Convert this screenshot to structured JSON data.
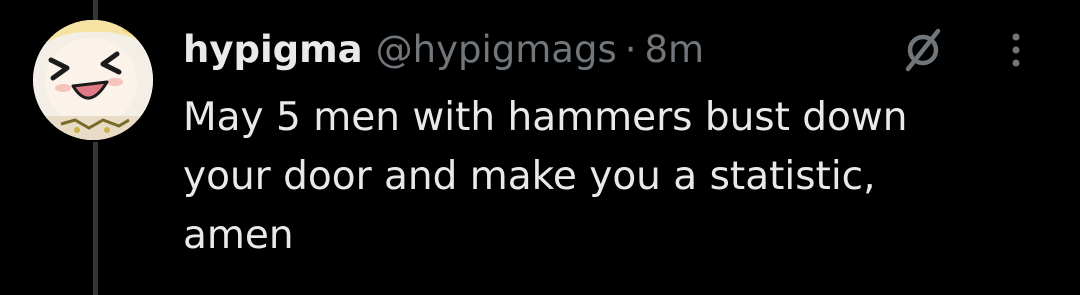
{
  "tweet": {
    "display_name": "hypigma",
    "handle": "@hypigmags",
    "separator": "·",
    "time": "8m",
    "text_lines": [
      "May 5 men with hammers bust down",
      "your door and make you a statistic,",
      "amen"
    ]
  },
  "icons": {
    "avatar": "anime-avatar",
    "grok": "grok-icon",
    "more": "more-options-icon"
  },
  "colors": {
    "background": "#000000",
    "text": "#e7e9ea",
    "muted": "#71767b",
    "thread_line": "#333639"
  }
}
